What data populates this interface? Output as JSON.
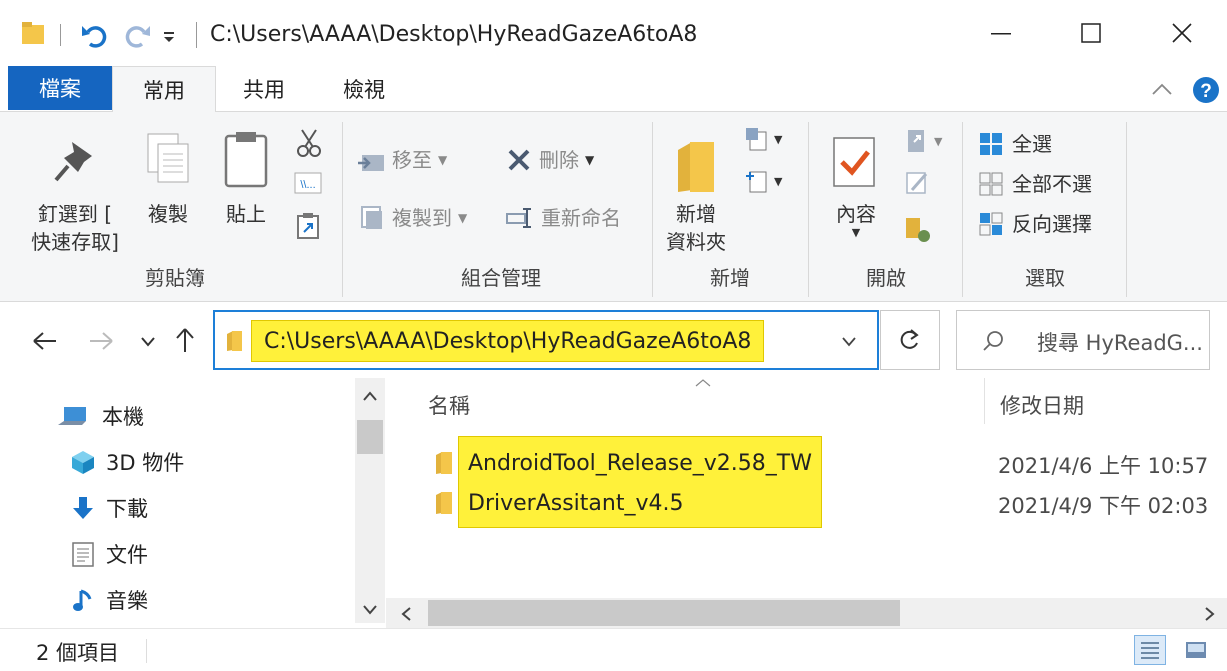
{
  "window": {
    "title": "C:\\Users\\AAAA\\Desktop\\HyReadGazeA6toA8"
  },
  "tabs": [
    {
      "label": "檔案"
    },
    {
      "label": "常用"
    },
    {
      "label": "共用"
    },
    {
      "label": "檢視"
    }
  ],
  "ribbon": {
    "clipboard": {
      "pin_label_1": "釘選到 [",
      "pin_label_2": "快速存取]",
      "copy_label": "複製",
      "paste_label": "貼上",
      "group_label": "剪貼簿"
    },
    "organize": {
      "move_to_label": "移至",
      "copy_to_label": "複製到",
      "delete_label": "刪除",
      "rename_label": "重新命名",
      "group_label": "組合管理"
    },
    "new": {
      "new_folder_label_1": "新增",
      "new_folder_label_2": "資料夾",
      "group_label": "新增"
    },
    "open": {
      "properties_label": "內容",
      "group_label": "開啟"
    },
    "select": {
      "select_all_label": "全選",
      "select_none_label": "全部不選",
      "invert_label": "反向選擇",
      "group_label": "選取"
    }
  },
  "address": {
    "path": "C:\\Users\\AAAA\\Desktop\\HyReadGazeA6toA8",
    "search_placeholder": "搜尋 HyReadG..."
  },
  "nav": {
    "items": [
      {
        "label": "本機",
        "icon": "pc-icon"
      },
      {
        "label": "3D 物件",
        "icon": "3d-objects-icon"
      },
      {
        "label": "下載",
        "icon": "download-icon"
      },
      {
        "label": "文件",
        "icon": "documents-icon"
      },
      {
        "label": "音樂",
        "icon": "music-icon"
      }
    ]
  },
  "content": {
    "columns": {
      "name": "名稱",
      "modified": "修改日期"
    },
    "files": [
      {
        "name": "AndroidTool_Release_v2.58_TW",
        "modified": "2021/4/6 上午 10:57"
      },
      {
        "name": "DriverAssitant_v4.5",
        "modified": "2021/4/9 下午 02:03"
      }
    ]
  },
  "status": {
    "count": "2 個項目"
  },
  "colors": {
    "accent": "#1d7fd8",
    "file_tab": "#1565c0",
    "highlight": "#fff13a",
    "folder": "#f4c64a"
  }
}
